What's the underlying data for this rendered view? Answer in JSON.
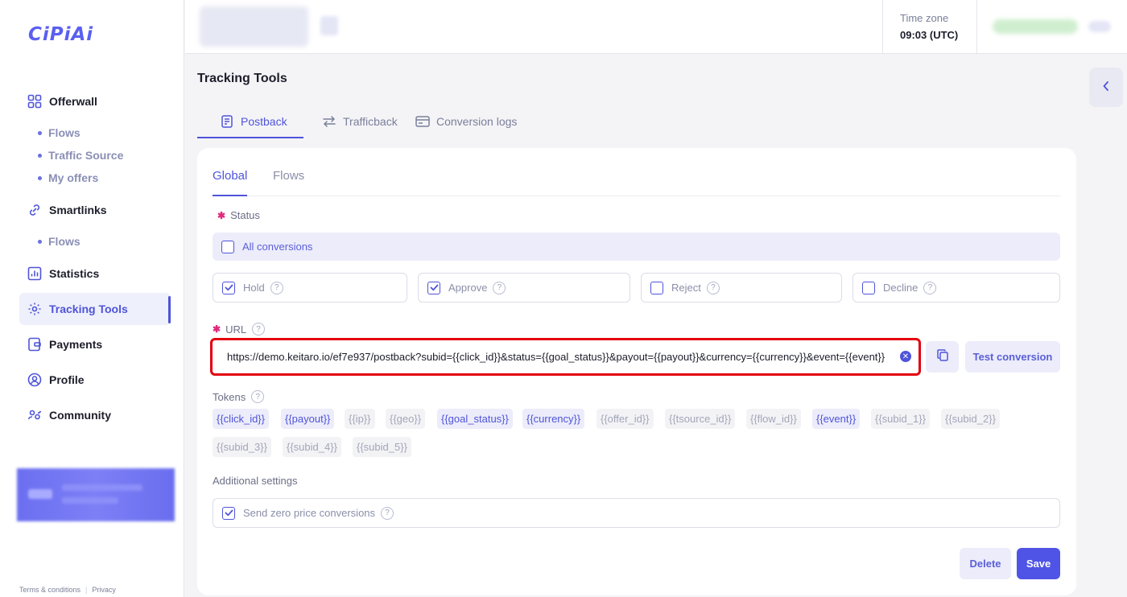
{
  "sidebar": {
    "logo": "CiPiAi",
    "nav": [
      {
        "label": "Offerwall",
        "icon": "grid-icon"
      },
      {
        "label": "Smartlinks",
        "icon": "link-icon"
      },
      {
        "label": "Statistics",
        "icon": "chart-icon"
      },
      {
        "label": "Tracking Tools",
        "icon": "gear-icon",
        "active": true
      },
      {
        "label": "Payments",
        "icon": "wallet-icon"
      },
      {
        "label": "Profile",
        "icon": "user-icon"
      },
      {
        "label": "Community",
        "icon": "community-icon"
      }
    ],
    "offerwall_sub": [
      "Flows",
      "Traffic Source",
      "My offers"
    ],
    "smartlinks_sub": [
      "Flows"
    ],
    "footer": {
      "terms": "Terms & conditions",
      "privacy": "Privacy"
    }
  },
  "header": {
    "timezone_label": "Time zone",
    "timezone_value": "09:03 (UTC)"
  },
  "page": {
    "title": "Tracking Tools",
    "tabs": [
      {
        "label": "Postback",
        "icon": "document-icon",
        "active": true
      },
      {
        "label": "Trafficback",
        "icon": "swap-icon"
      },
      {
        "label": "Conversion logs",
        "icon": "card-icon"
      }
    ]
  },
  "form": {
    "subtabs": [
      {
        "label": "Global",
        "active": true
      },
      {
        "label": "Flows"
      }
    ],
    "status_label": "Status",
    "all_conversions": {
      "label": "All conversions",
      "checked": false
    },
    "statuses": [
      {
        "label": "Hold",
        "checked": true
      },
      {
        "label": "Approve",
        "checked": true
      },
      {
        "label": "Reject",
        "checked": false
      },
      {
        "label": "Decline",
        "checked": false
      }
    ],
    "url_label": "URL",
    "url_value": "https://demo.keitaro.io/ef7e937/postback?subid={{click_id}}&status={{goal_status}}&payout={{payout}}&currency={{currency}}&event={{event}}",
    "test_conversion": "Test conversion",
    "tokens_label": "Tokens",
    "tokens": [
      {
        "label": "{{click_id}}",
        "active": true
      },
      {
        "label": "{{payout}}",
        "active": true
      },
      {
        "label": "{{ip}}",
        "active": false
      },
      {
        "label": "{{geo}}",
        "active": false
      },
      {
        "label": "{{goal_status}}",
        "active": true
      },
      {
        "label": "{{currency}}",
        "active": true
      },
      {
        "label": "{{offer_id}}",
        "active": false
      },
      {
        "label": "{{tsource_id}}",
        "active": false
      },
      {
        "label": "{{flow_id}}",
        "active": false
      },
      {
        "label": "{{event}}",
        "active": true
      },
      {
        "label": "{{subid_1}}",
        "active": false
      },
      {
        "label": "{{subid_2}}",
        "active": false
      },
      {
        "label": "{{subid_3}}",
        "active": false
      },
      {
        "label": "{{subid_4}}",
        "active": false
      },
      {
        "label": "{{subid_5}}",
        "active": false
      }
    ],
    "additional_label": "Additional settings",
    "zero_price": {
      "label": "Send zero price conversions",
      "checked": true
    },
    "delete_label": "Delete",
    "save_label": "Save"
  },
  "colors": {
    "accent": "#4f54d9",
    "highlight": "#e3000f",
    "required": "#e0297c"
  }
}
